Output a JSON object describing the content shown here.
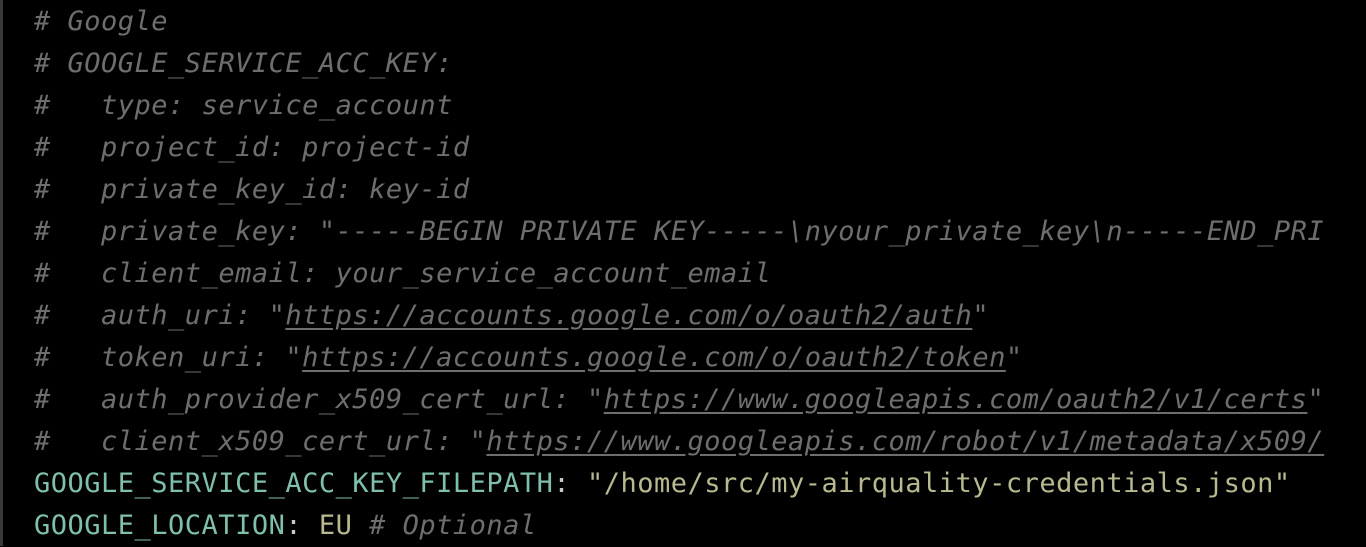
{
  "lines": [
    {
      "hash": "#",
      "text": " Google"
    },
    {
      "hash": "#",
      "text": " GOOGLE_SERVICE_ACC_KEY:"
    },
    {
      "hash": "#",
      "text": "   type: service_account"
    },
    {
      "hash": "#",
      "text": "   project_id: project-id"
    },
    {
      "hash": "#",
      "text": "   private_key_id: key-id"
    },
    {
      "hash": "#",
      "text": "   private_key: \"-----BEGIN PRIVATE KEY-----\\nyour_private_key\\n-----END_PRI"
    },
    {
      "hash": "#",
      "text": "   client_email: your_service_account_email"
    },
    {
      "hash": "#",
      "pre": "   auth_uri: \"",
      "url": "https://accounts.google.com/o/oauth2/auth",
      "post": "\""
    },
    {
      "hash": "#",
      "pre": "   token_uri: \"",
      "url": "https://accounts.google.com/o/oauth2/token",
      "post": "\""
    },
    {
      "hash": "#",
      "pre": "   auth_provider_x509_cert_url: \"",
      "url": "https://www.googleapis.com/oauth2/v1/certs",
      "post": "\""
    },
    {
      "hash": "#",
      "pre": "   client_x509_cert_url: \"",
      "url": "https://www.googleapis.com/robot/v1/metadata/x509/",
      "post": ""
    }
  ],
  "filepath_line": {
    "key": "GOOGLE_SERVICE_ACC_KEY_FILEPATH",
    "colon": ": ",
    "value": "\"/home/src/my-airquality-credentials.json\""
  },
  "location_line": {
    "key": "GOOGLE_LOCATION",
    "colon": ": ",
    "value": "EU",
    "comment": " # Optional"
  },
  "colors": {
    "background": "#000000",
    "comment": "#6e6e6e",
    "key": "#7fbfae",
    "string": "#b9b98f"
  }
}
